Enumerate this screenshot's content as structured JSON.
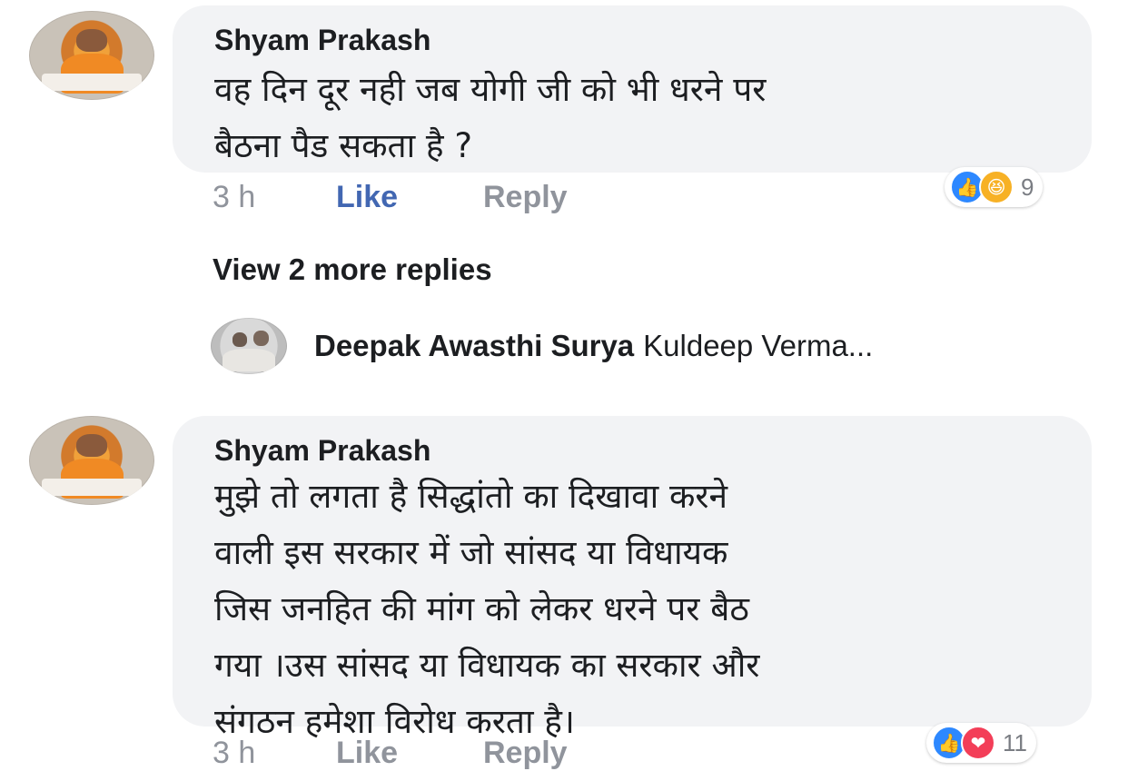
{
  "comments": [
    {
      "author": "Shyam Prakash",
      "lines": [
        "वह दिन दूर नही जब योगी जी को भी धरने पर",
        "बैठना पैड सकता है ?"
      ],
      "time": "3 h",
      "like_label": "Like",
      "reply_label": "Reply",
      "reaction_count": "9",
      "reactions": [
        "like-icon",
        "haha-icon"
      ]
    },
    {
      "author": "Shyam Prakash",
      "lines": [
        "मुझे तो लगता है सिद्धांतो का दिखावा करने",
        "वाली इस सरकार में जो सांसद या विधायक",
        "जिस जनहित की  मांग को लेकर धरने पर बैठ",
        "गया ।उस सांसद या विधायक का सरकार और",
        "संगठन हमेशा विरोध करता है।"
      ],
      "time": "3 h",
      "like_label": "Like",
      "reply_label": "Reply",
      "reaction_count": "11",
      "reactions": [
        "like-icon",
        "love-icon"
      ]
    }
  ],
  "view_more": "View 2 more replies",
  "latest_reply": {
    "author": "Deepak Awasthi Surya",
    "text": "Kuldeep Verma..."
  }
}
